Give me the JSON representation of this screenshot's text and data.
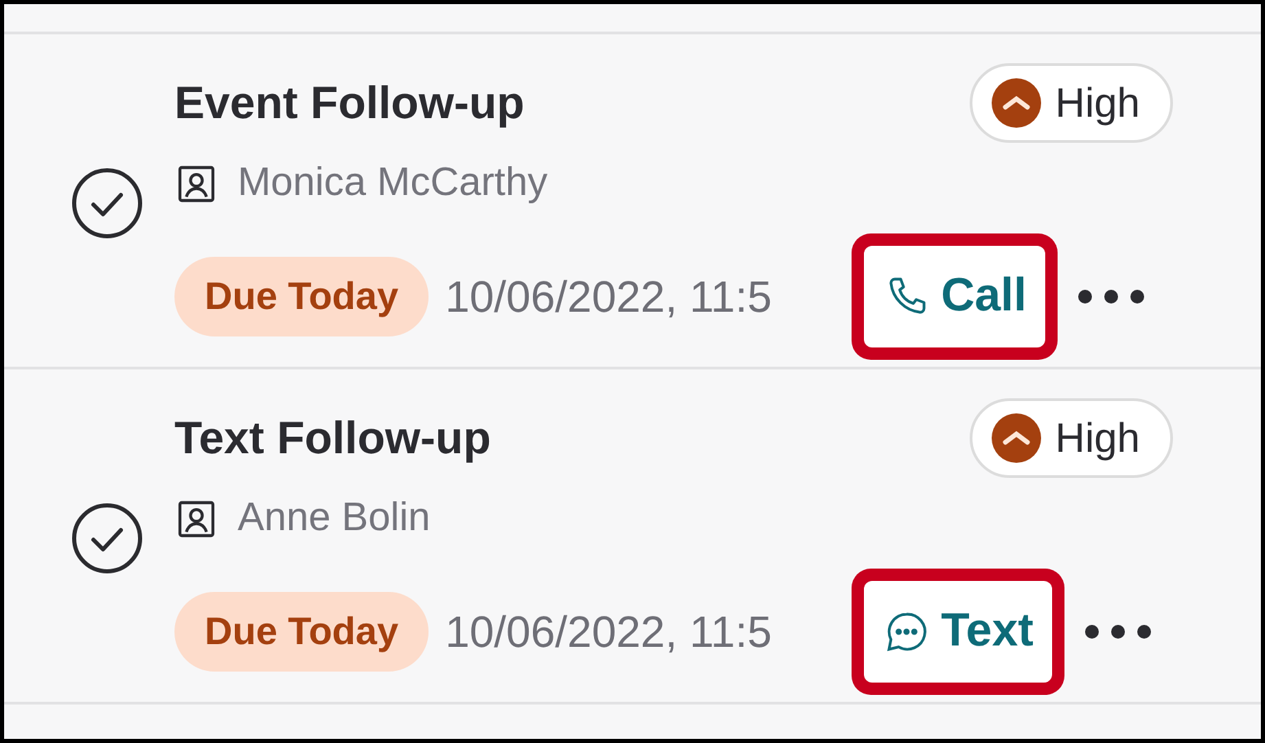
{
  "tasks": [
    {
      "title": "Event Follow-up",
      "priority": "High",
      "contact": "Monica McCarthy",
      "due_label": "Due Today",
      "due_date": "10/06/2022, 11:5",
      "action": {
        "kind": "call",
        "label": "Call",
        "highlighted": true
      }
    },
    {
      "title": "Text Follow-up",
      "priority": "High",
      "contact": "Anne Bolin",
      "due_label": "Due Today",
      "due_date": "10/06/2022, 11:5",
      "action": {
        "kind": "text",
        "label": "Text",
        "highlighted": true
      }
    }
  ]
}
